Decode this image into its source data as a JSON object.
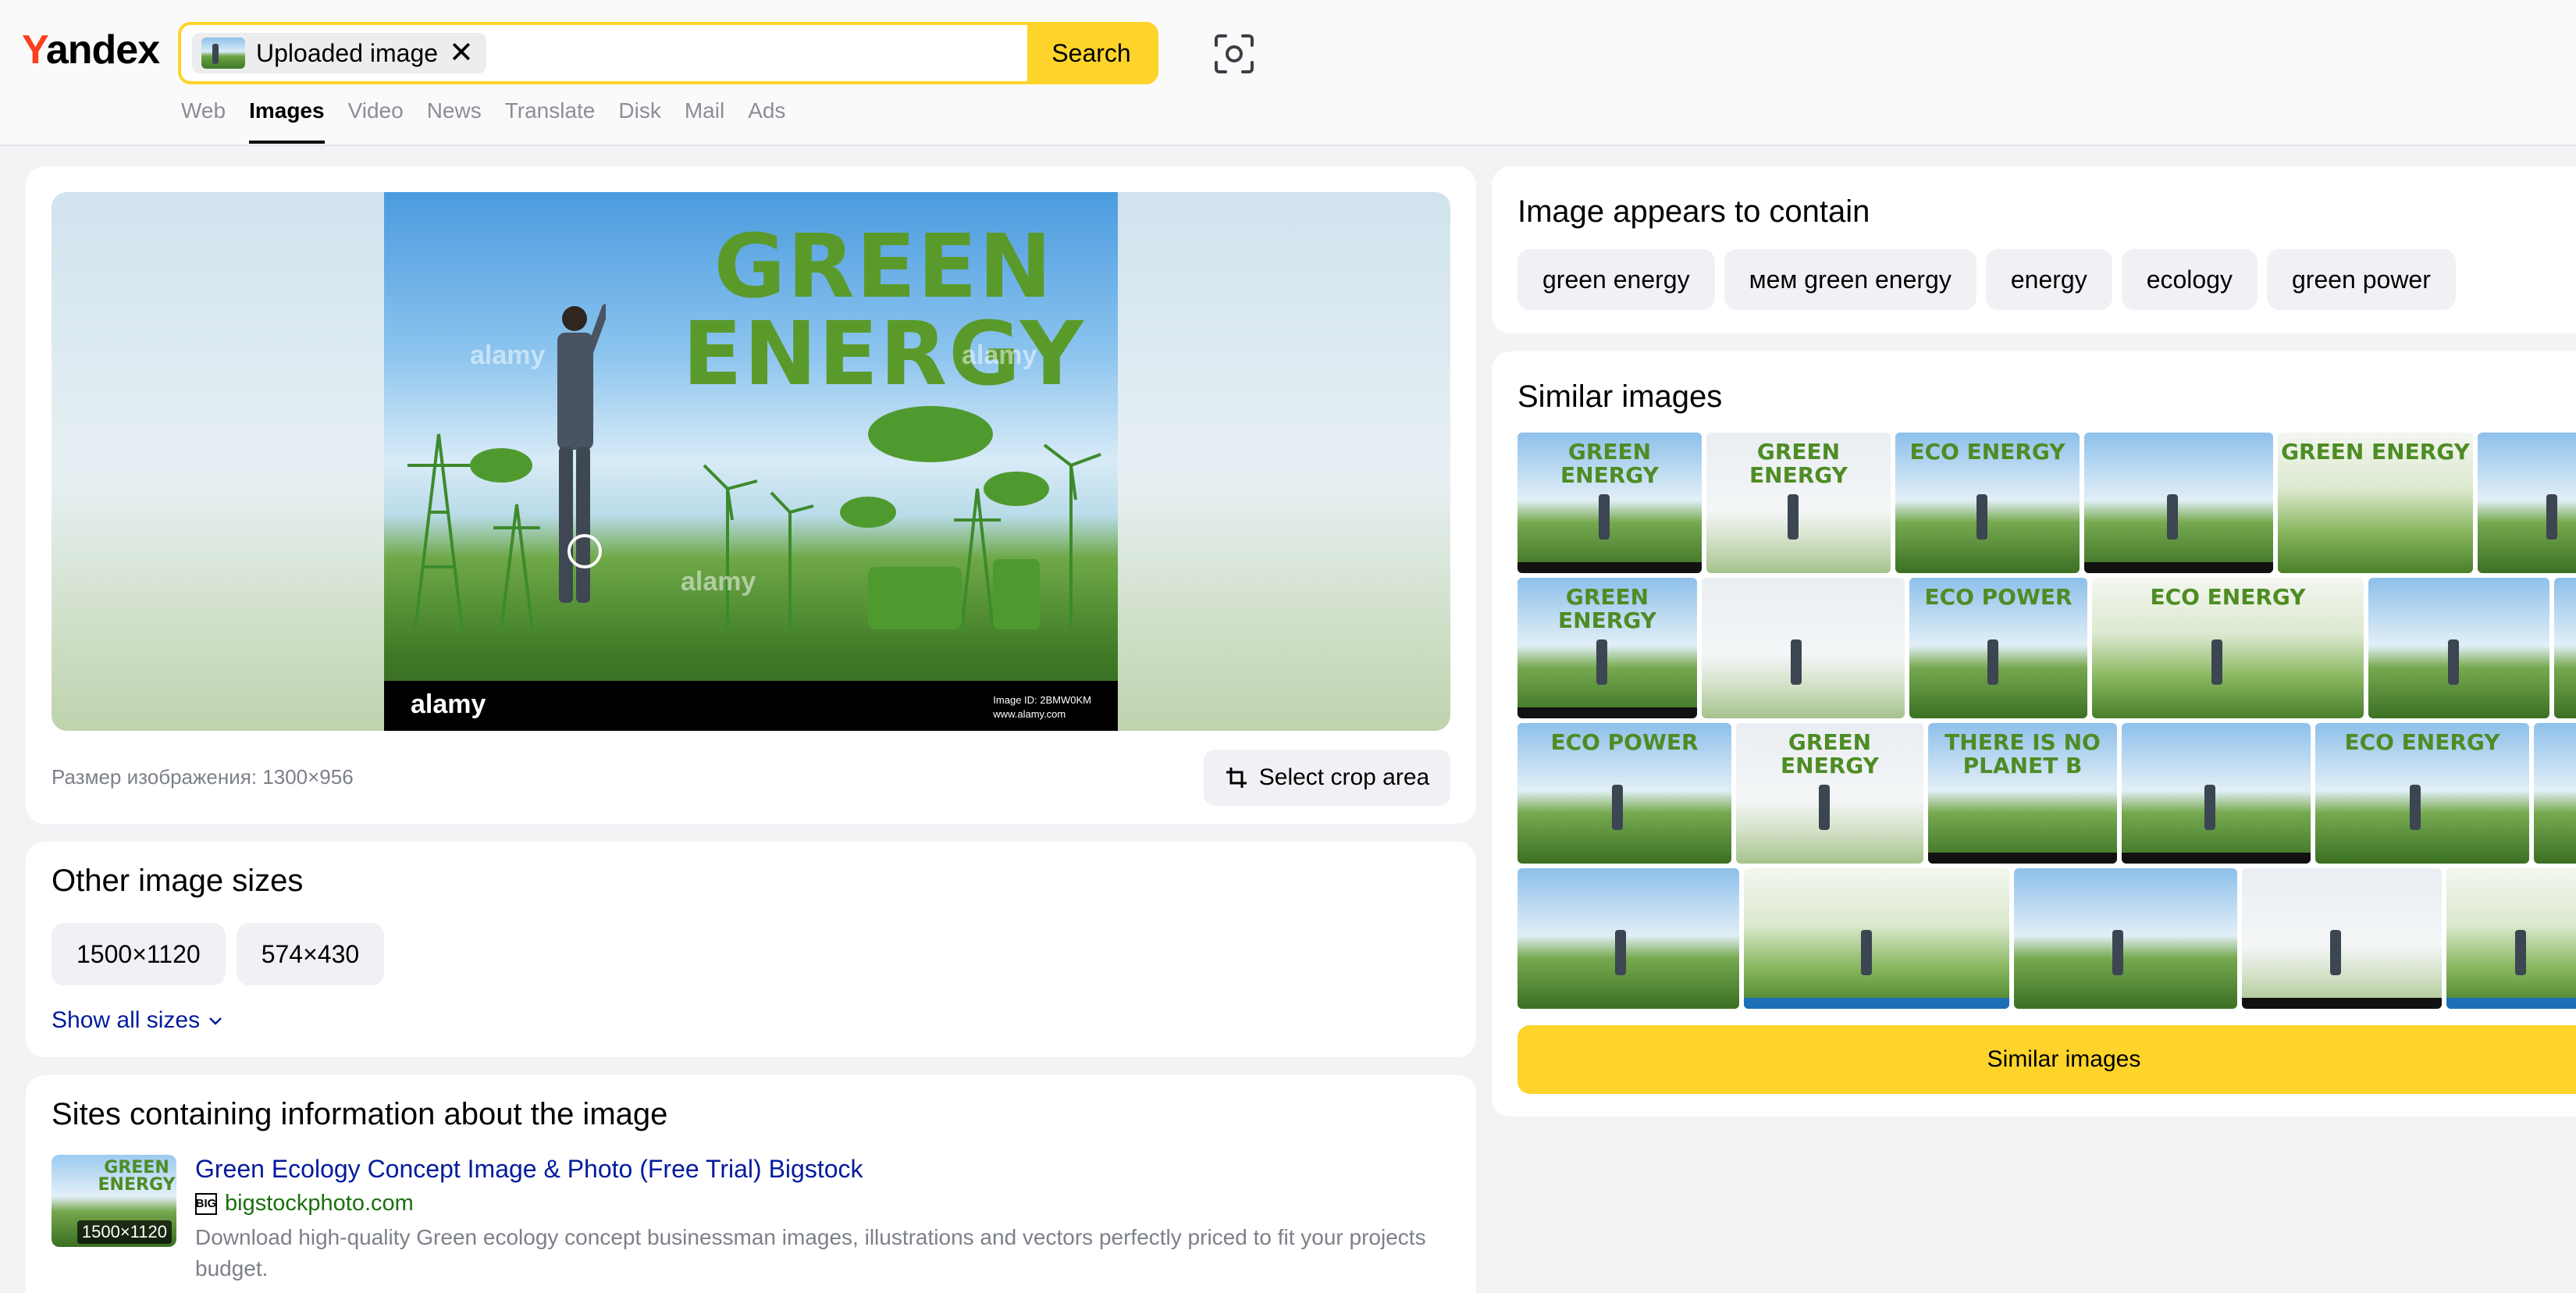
{
  "header": {
    "logo_first": "Y",
    "logo_rest": "andex",
    "upload_chip_label": "Uploaded image",
    "upload_chip_close": "✕",
    "search_button": "Search",
    "nav": [
      {
        "label": "Web",
        "active": false
      },
      {
        "label": "Images",
        "active": true
      },
      {
        "label": "Video",
        "active": false
      },
      {
        "label": "News",
        "active": false
      },
      {
        "label": "Translate",
        "active": false
      },
      {
        "label": "Disk",
        "active": false
      },
      {
        "label": "Mail",
        "active": false
      },
      {
        "label": "Ads",
        "active": false
      }
    ]
  },
  "preview": {
    "photo_title": "GREEN ENERGY",
    "photo_brand": "alamy",
    "photo_meta_line1": "Image ID: 2BMW0KM",
    "photo_meta_line2": "www.alamy.com",
    "watermark": "alamy",
    "size_text": "Размер изображения: 1300×956",
    "crop_button": "Select crop area"
  },
  "other_sizes": {
    "title": "Other image sizes",
    "sizes": [
      "1500×1120",
      "574×430"
    ],
    "show_all": "Show all sizes"
  },
  "sites": {
    "title": "Sites containing information about the image",
    "items": [
      {
        "thumb_text": "GREEN ENERGY",
        "thumb_badge": "1500×1120",
        "favicon": "BIG",
        "title": "Green Ecology Concept Image & Photo (Free Trial) Bigstock",
        "domain": "bigstockphoto.com",
        "description": "Download high-quality Green ecology concept businessman images, illustrations and vectors perfectly priced to fit your projects budget."
      }
    ]
  },
  "contains": {
    "title": "Image appears to contain",
    "tags": [
      "green energy",
      "мем green energy",
      "energy",
      "ecology",
      "green power"
    ]
  },
  "similar": {
    "title": "Similar images",
    "button": "Similar images",
    "thumb_labels": [
      "GREEN ENERGY",
      "GREEN ENERGY",
      "ECO ENERGY",
      "GREEN ENERGY",
      "ECO POWER",
      "ECO ENERGY",
      "ECO POWER",
      "GREEN ENERGY",
      "THERE IS NO PLANET B",
      "ECO ENERGY"
    ]
  },
  "colors": {
    "accent_yellow": "#fed42b",
    "logo_red": "#fc3f1d",
    "link_blue": "#001b9e",
    "domain_green": "#1b6f0f"
  }
}
